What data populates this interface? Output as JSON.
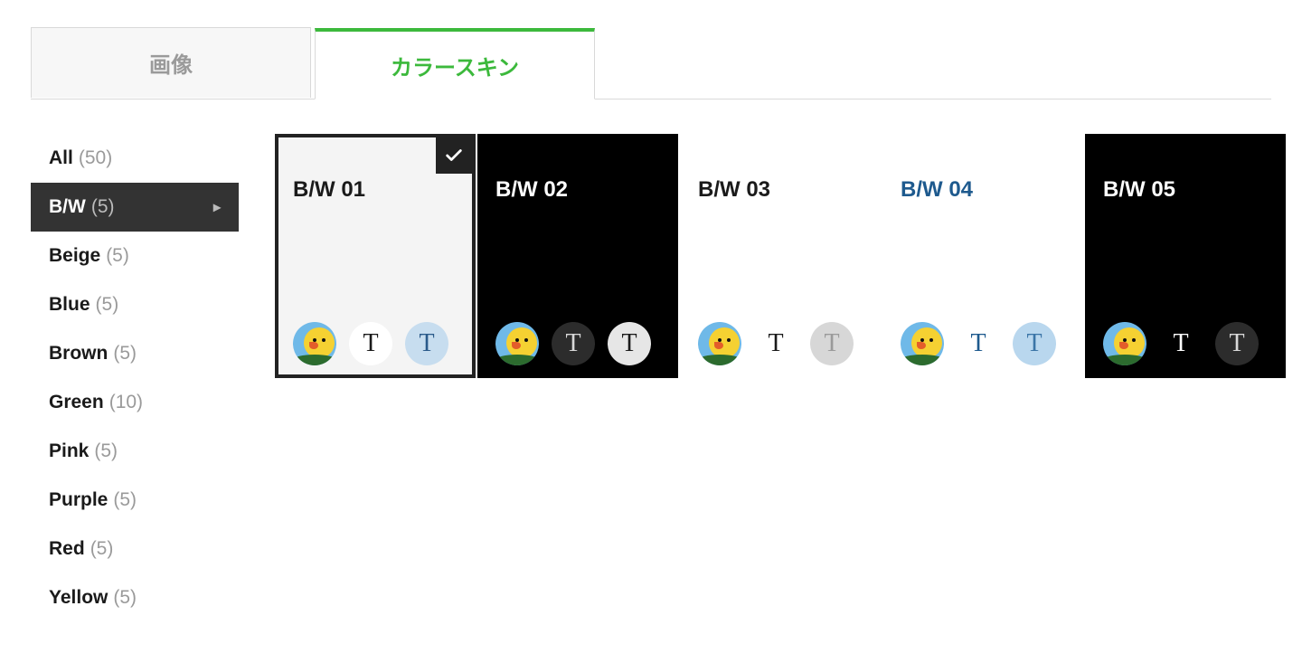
{
  "tabs": [
    {
      "label": "画像",
      "active": false
    },
    {
      "label": "カラースキン",
      "active": true
    }
  ],
  "sidebar": [
    {
      "name": "All",
      "count": "(50)",
      "active": false
    },
    {
      "name": "B/W",
      "count": "(5)",
      "active": true
    },
    {
      "name": "Beige",
      "count": "(5)",
      "active": false
    },
    {
      "name": "Blue",
      "count": "(5)",
      "active": false
    },
    {
      "name": "Brown",
      "count": "(5)",
      "active": false
    },
    {
      "name": "Green",
      "count": "(10)",
      "active": false
    },
    {
      "name": "Pink",
      "count": "(5)",
      "active": false
    },
    {
      "name": "Purple",
      "count": "(5)",
      "active": false
    },
    {
      "name": "Red",
      "count": "(5)",
      "active": false
    },
    {
      "name": "Yellow",
      "count": "(5)",
      "active": false
    }
  ],
  "cards": [
    {
      "title": "B/W 01",
      "bg": "#f4f4f4",
      "fg": "#1a1a1a",
      "selected": true,
      "t1": {
        "bg": "#ffffff",
        "fg": "#1a1a1a"
      },
      "t2": {
        "bg": "#c7ddef",
        "fg": "#2a5a8a"
      }
    },
    {
      "title": "B/W 02",
      "bg": "#000000",
      "fg": "#ffffff",
      "selected": false,
      "t1": {
        "bg": "#2c2c2c",
        "fg": "#d8d8d8"
      },
      "t2": {
        "bg": "#e6e6e6",
        "fg": "#1a1a1a"
      }
    },
    {
      "title": "B/W 03",
      "bg": "#ffffff",
      "fg": "#1a1a1a",
      "selected": false,
      "t1": {
        "bg": "#ffffff",
        "fg": "#1a1a1a"
      },
      "t2": {
        "bg": "#d7d7d7",
        "fg": "#9a9a9a"
      }
    },
    {
      "title": "B/W 04",
      "bg": "#ffffff",
      "fg": "#1e5a8e",
      "selected": false,
      "t1": {
        "bg": "#ffffff",
        "fg": "#1e5a8e"
      },
      "t2": {
        "bg": "#b9d7ee",
        "fg": "#3b75a7"
      }
    },
    {
      "title": "B/W 05",
      "bg": "#000000",
      "fg": "#ffffff",
      "selected": false,
      "t1": {
        "bg": "#000000",
        "fg": "#ffffff"
      },
      "t2": {
        "bg": "#2c2c2c",
        "fg": "#d8d8d8"
      }
    }
  ],
  "tokens": {
    "T": "T"
  }
}
